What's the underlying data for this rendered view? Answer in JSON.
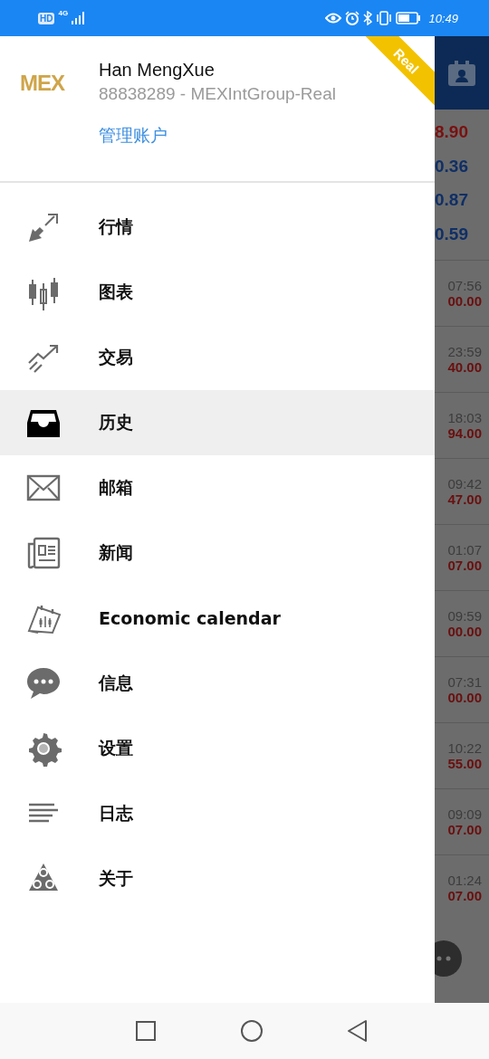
{
  "status_bar": {
    "hd": "HD",
    "network": "4G",
    "time": "10:49"
  },
  "account": {
    "logo": "MEX",
    "name": "Han MengXue",
    "number": "88838289 - MEXIntGroup-Real",
    "manage_link": "管理账户",
    "badge": "Real"
  },
  "menu": [
    {
      "label": "行情",
      "selected": false
    },
    {
      "label": "图表",
      "selected": false
    },
    {
      "label": "交易",
      "selected": false
    },
    {
      "label": "历史",
      "selected": true
    },
    {
      "label": "邮箱",
      "selected": false
    },
    {
      "label": "新闻",
      "selected": false
    },
    {
      "label": "Economic calendar",
      "selected": false
    },
    {
      "label": "信息",
      "selected": false
    },
    {
      "label": "设置",
      "selected": false
    },
    {
      "label": "日志",
      "selected": false
    },
    {
      "label": "关于",
      "selected": false
    }
  ],
  "background_screen": {
    "quotes": [
      {
        "value": "8.90",
        "color": "#7a1010"
      },
      {
        "value": "0.36",
        "color": "#0f2f66"
      },
      {
        "value": "0.87",
        "color": "#0f2f66"
      },
      {
        "value": "0.59",
        "color": "#0f2f66"
      }
    ],
    "deals": [
      {
        "time": "07:56",
        "amount": "00.00"
      },
      {
        "time": "23:59",
        "amount": "40.00"
      },
      {
        "time": "18:03",
        "amount": "94.00"
      },
      {
        "time": "09:42",
        "amount": "47.00"
      },
      {
        "time": "01:07",
        "amount": "07.00"
      },
      {
        "time": "09:59",
        "amount": "00.00"
      },
      {
        "time": "07:31",
        "amount": "00.00"
      },
      {
        "time": "10:22",
        "amount": "55.00"
      },
      {
        "time": "09:09",
        "amount": "07.00"
      },
      {
        "time": "01:24",
        "amount": "07.00"
      }
    ]
  }
}
